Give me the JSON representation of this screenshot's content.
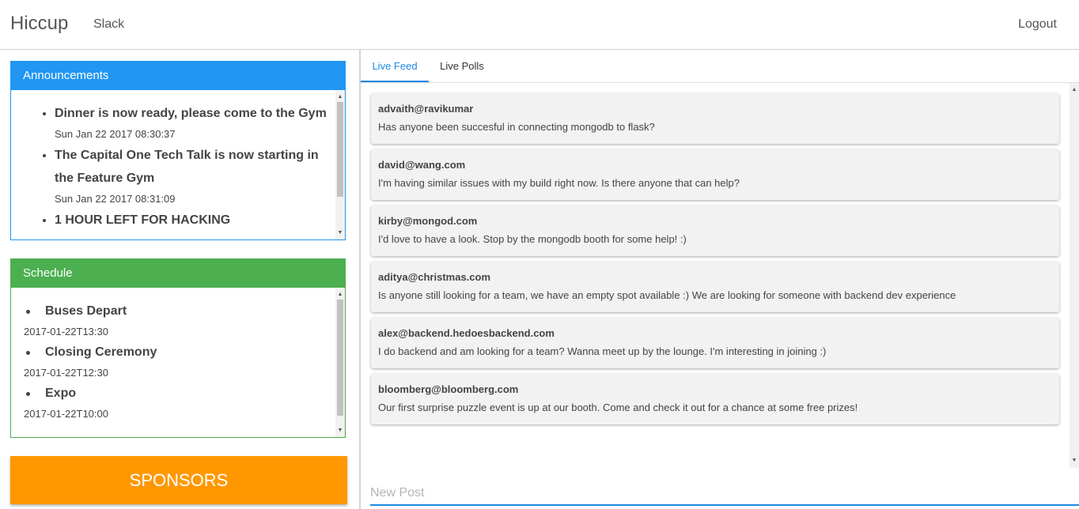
{
  "header": {
    "brand": "Hiccup",
    "slack": "Slack",
    "logout": "Logout"
  },
  "announcements": {
    "title": "Announcements",
    "items": [
      {
        "text": "Dinner is now ready, please come to the Gym",
        "time": "Sun Jan 22 2017 08:30:37"
      },
      {
        "text": "The Capital One Tech Talk is now starting in the Feature Gym",
        "time": "Sun Jan 22 2017 08:31:09"
      },
      {
        "text": "1 HOUR LEFT FOR HACKING",
        "time": ""
      }
    ]
  },
  "schedule": {
    "title": "Schedule",
    "items": [
      {
        "name": "Buses Depart",
        "time": "2017-01-22T13:30"
      },
      {
        "name": "Closing Ceremony",
        "time": "2017-01-22T12:30"
      },
      {
        "name": "Expo",
        "time": "2017-01-22T10:00"
      }
    ]
  },
  "sponsors": {
    "label": "SPONSORS"
  },
  "tabs": {
    "feed": "Live Feed",
    "polls": "Live Polls",
    "active": "Live Feed"
  },
  "feed": [
    {
      "author": "advaith@ravikumar",
      "message": "Has anyone been succesful in connecting mongodb to flask?"
    },
    {
      "author": "david@wang.com",
      "message": "I'm having similar issues with my build right now. Is there anyone that can help?"
    },
    {
      "author": "kirby@mongod.com",
      "message": "I'd love to have a look. Stop by the mongodb booth for some help! :)"
    },
    {
      "author": "aditya@christmas.com",
      "message": "Is anyone still looking for a team, we have an empty spot available :) We are looking for someone with backend dev experience"
    },
    {
      "author": "alex@backend.hedoesbackend.com",
      "message": "I do backend and am looking for a team? Wanna meet up by the lounge. I'm interesting in joining :)"
    },
    {
      "author": "bloomberg@bloomberg.com",
      "message": "Our first surprise puzzle event is up at our booth. Come and check it out for a chance at some free prizes!"
    }
  ],
  "composer": {
    "placeholder": "New Post",
    "value": ""
  },
  "colors": {
    "announcements": "#2196f3",
    "schedule": "#4caf50",
    "sponsors": "#ff9800",
    "accent": "#1e88e5"
  }
}
